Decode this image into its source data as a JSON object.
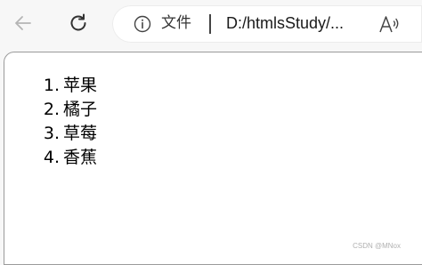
{
  "toolbar": {
    "back_icon": "arrow-left-icon",
    "reload_icon": "reload-icon",
    "address": {
      "info_icon": "info-icon",
      "file_label": "文件",
      "url": "D:/htmlsStudy/...",
      "read_aloud_icon": "read-aloud-icon"
    }
  },
  "page": {
    "list": [
      {
        "num": "1.",
        "text": "苹果"
      },
      {
        "num": "2.",
        "text": "橘子"
      },
      {
        "num": "3.",
        "text": "草莓"
      },
      {
        "num": "4.",
        "text": "香蕉"
      }
    ]
  },
  "watermark": "CSDN @MNox",
  "colors": {
    "chrome_bg": "#f7f7f7",
    "page_bg": "#ffffff",
    "icon_disabled": "#b5b5b5",
    "icon_active": "#333333"
  }
}
